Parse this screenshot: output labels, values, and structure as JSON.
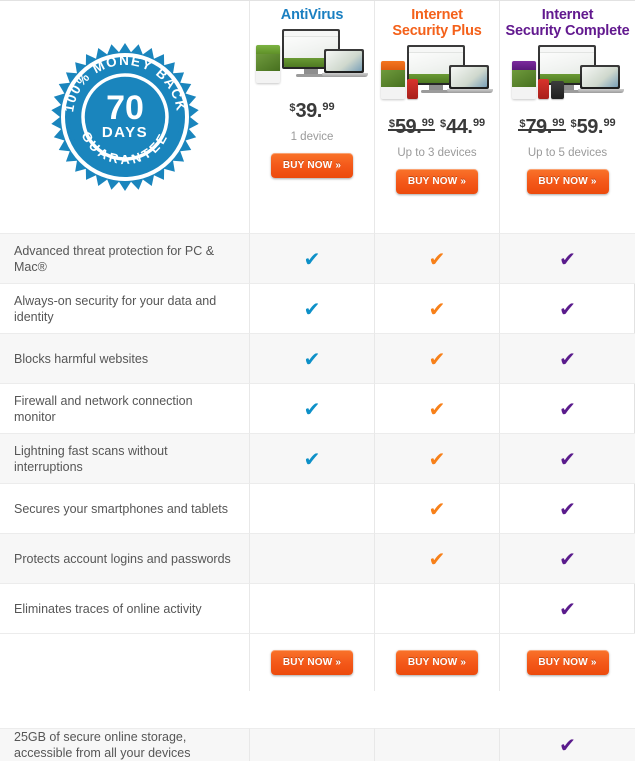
{
  "guarantee_badge": {
    "icon": "money-back-guarantee-seal",
    "top_arc_text": "100% MONEY BACK",
    "days_number": "70",
    "days_label": "DAYS",
    "bottom_arc_text": "GUARANTEE",
    "color": "#1a85bd"
  },
  "plans": [
    {
      "title": "AntiVirus",
      "title_color": "#1a7fc1",
      "accent": "#0d90c8",
      "box_color": "green",
      "has_phone": false,
      "has_tablet": false,
      "old_price": null,
      "price_currency": "$",
      "price_whole": "39",
      "price_cents": "99",
      "devices": "1 device",
      "buy_label": "BUY NOW »"
    },
    {
      "title": "Internet\nSecurity Plus",
      "title_line1": "Internet",
      "title_line2": "Security Plus",
      "title_color": "#f4611a",
      "accent": "#f78019",
      "box_color": "orange",
      "has_phone": true,
      "has_tablet": false,
      "old_price_currency": "$",
      "old_price_whole": "59",
      "old_price_cents": "99",
      "price_currency": "$",
      "price_whole": "44",
      "price_cents": "99",
      "devices": "Up to 3 devices",
      "buy_label": "BUY NOW »"
    },
    {
      "title": "Internet\nSecurity Complete",
      "title_line1": "Internet",
      "title_line2": "Security Complete",
      "title_color": "#62198f",
      "accent": "#5a1b8c",
      "box_color": "purple",
      "has_phone": true,
      "has_tablet": true,
      "old_price_currency": "$",
      "old_price_whole": "79",
      "old_price_cents": "99",
      "price_currency": "$",
      "price_whole": "59",
      "price_cents": "99",
      "devices": "Up to 5 devices",
      "buy_label": "BUY NOW »"
    }
  ],
  "check_glyph": "✔",
  "features": [
    {
      "label": "Advanced threat protection for PC & Mac®",
      "antivirus": true,
      "plus": true,
      "complete": true
    },
    {
      "label": "Always-on security for your data and identity",
      "antivirus": true,
      "plus": true,
      "complete": true
    },
    {
      "label": "Blocks harmful websites",
      "antivirus": true,
      "plus": true,
      "complete": true
    },
    {
      "label": "Firewall and network connection monitor",
      "antivirus": true,
      "plus": true,
      "complete": true
    },
    {
      "label": "Lightning fast scans without interruptions",
      "antivirus": true,
      "plus": true,
      "complete": true
    },
    {
      "label": "Secures your smartphones and tablets",
      "antivirus": false,
      "plus": true,
      "complete": true
    },
    {
      "label": "Protects account logins and passwords",
      "antivirus": false,
      "plus": true,
      "complete": true
    },
    {
      "label": "Eliminates traces of online activity",
      "antivirus": false,
      "plus": false,
      "complete": true
    },
    {
      "label": "25GB of secure online storage, accessible from all your devices",
      "antivirus": false,
      "plus": false,
      "complete": true
    }
  ],
  "footer": {
    "buy_label_1": "BUY NOW »",
    "buy_label_2": "BUY NOW »",
    "buy_label_3": "BUY NOW »"
  }
}
